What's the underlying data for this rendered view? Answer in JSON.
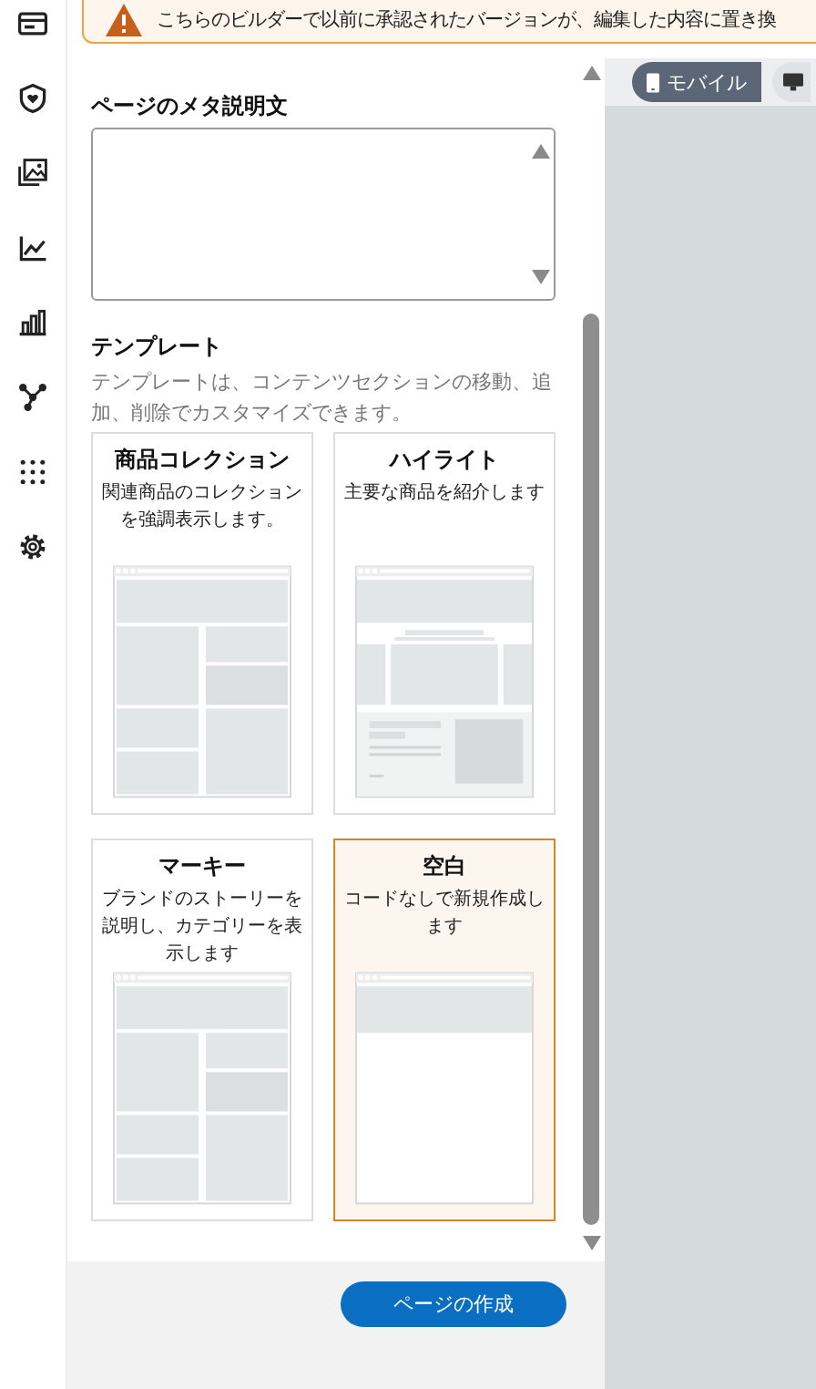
{
  "alert": {
    "text": "こちらのビルダーで以前に承認されたバージョンが、編集した内容に置き換"
  },
  "meta_description": {
    "label": "ページのメタ説明文"
  },
  "templates": {
    "title": "テンプレート",
    "description": "テンプレートは、コンテンツセクションの移動、追加、削除でカスタマイズできます。",
    "items": [
      {
        "name": "商品コレクション",
        "description": "関連商品のコレクションを強調表示します。",
        "kind": "collection",
        "selected": false
      },
      {
        "name": "ハイライト",
        "description": "主要な商品を紹介します",
        "kind": "highlight",
        "selected": false
      },
      {
        "name": "マーキー",
        "description": "ブランドのストーリーを説明し、カテゴリーを表示します",
        "kind": "collection",
        "selected": false
      },
      {
        "name": "空白",
        "description": "コードなしで新規作成します",
        "kind": "blank",
        "selected": true
      }
    ]
  },
  "preview_toolbar": {
    "modes": [
      {
        "kind": "mobile",
        "label": "モバイル",
        "selected": true
      },
      {
        "kind": "desktop",
        "selected": false
      }
    ]
  },
  "create_button": {
    "label": "ページの作成"
  }
}
